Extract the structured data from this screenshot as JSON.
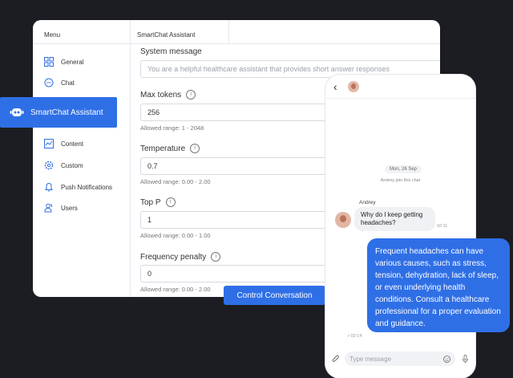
{
  "menu": {
    "title": "Menu",
    "items": [
      {
        "label": "General",
        "icon": "grid-icon"
      },
      {
        "label": "Chat",
        "icon": "chat-bubble-icon"
      },
      {
        "label": "SmartChat Assistant",
        "icon": "robot-icon",
        "selected": true
      },
      {
        "label": "Content",
        "icon": "chart-line-icon"
      },
      {
        "label": "Custom",
        "icon": "gear-icon"
      },
      {
        "label": "Push Notifications",
        "icon": "bell-icon"
      },
      {
        "label": "Users",
        "icon": "users-icon"
      }
    ]
  },
  "panel": {
    "title": "SmartChat Assistant",
    "system_message": {
      "label": "System message",
      "placeholder": "You are a helpful healthcare assistant that provides short answer responses"
    },
    "max_tokens": {
      "label": "Max tokens",
      "value": "256",
      "hint": "Allowed range: 1 - 2048"
    },
    "temperature": {
      "label": "Temperature",
      "value": "0.7",
      "hint": "Allowed range: 0.00 - 2.00"
    },
    "top_p": {
      "label": "Top P",
      "value": "1",
      "hint": "Allowed range: 0.00 - 1.00"
    },
    "frequency_penalty": {
      "label": "Frequency penalty",
      "value": "0",
      "hint": "Allowed range: 0.00 - 2.00"
    },
    "control_button": "Control Conversation"
  },
  "chat": {
    "date": "Mon, 26 Sep",
    "join_note": "Andrey join this chat",
    "sender": "Andrey",
    "incoming_message": "Why do I keep getting headaches?",
    "incoming_time": "02:11",
    "outgoing_message": "Frequent headaches can have various causes, such as stress, tension, dehydration, lack of sleep, or even underlying health conditions. Consult a healthcare professional for a proper evaluation and guidance.",
    "outgoing_time": "02:14",
    "input_placeholder": "Type message"
  },
  "colors": {
    "accent": "#2f6fe6",
    "background": "#1c1d22"
  }
}
